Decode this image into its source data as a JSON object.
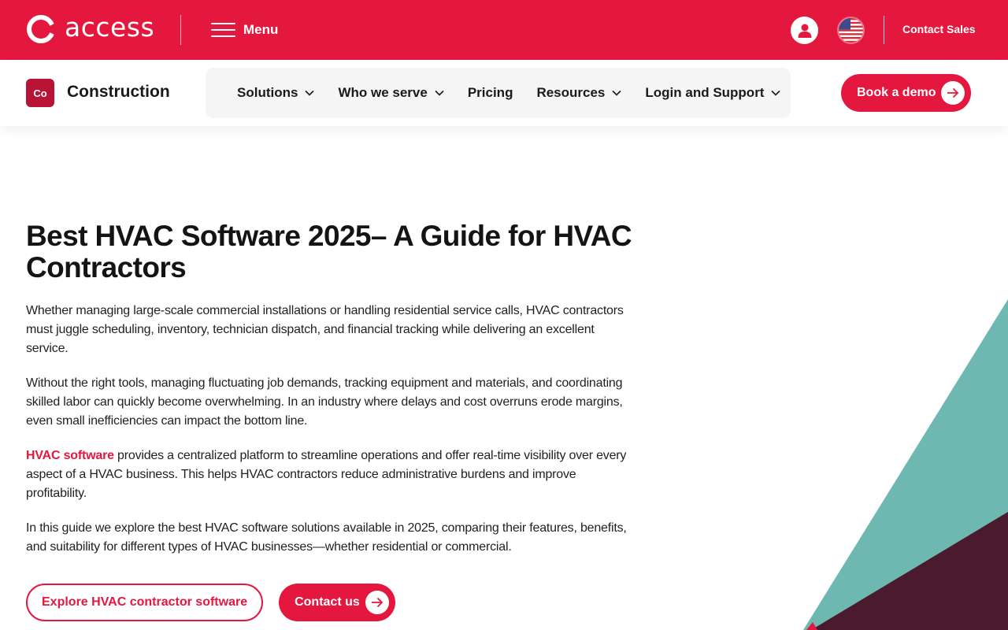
{
  "brand": {
    "logo_text": "access",
    "menu_label": "Menu",
    "contact_sales": "Contact Sales",
    "accent_color": "#e4173e",
    "user_icon": "user-icon",
    "flag_icon": "us-flag-icon"
  },
  "subnav": {
    "badge": "Co",
    "product_name": "Construction",
    "items": [
      {
        "label": "Solutions",
        "has_dropdown": true
      },
      {
        "label": "Who we serve",
        "has_dropdown": true
      },
      {
        "label": "Pricing",
        "has_dropdown": false
      },
      {
        "label": "Resources",
        "has_dropdown": true
      },
      {
        "label": "Login and Support",
        "has_dropdown": true
      }
    ],
    "book_demo": "Book a demo"
  },
  "article": {
    "title": "Best HVAC Software 2025– A Guide for HVAC Contractors",
    "p1": "Whether managing large-scale commercial installations or handling residential service calls, HVAC contractors must juggle scheduling, inventory, technician dispatch, and financial tracking while delivering an excellent service.",
    "p2": "Without the right tools, managing fluctuating job demands, tracking equipment and materials, and coordinating skilled labor can quickly become overwhelming. In an industry where delays and cost overruns erode margins, even small inefficiencies can impact the bottom line.",
    "p3_link": "HVAC software",
    "p3_rest": " provides a centralized platform to streamline operations and offer real-time visibility over every aspect of a HVAC business. This helps HVAC contractors reduce administrative burdens and improve profitability.",
    "p4": "In this guide we explore the best HVAC software solutions available in 2025, comparing their features, benefits, and suitability for different types of HVAC businesses—whether residential or commercial."
  },
  "cta": {
    "explore": "Explore HVAC contractor software",
    "contact": "Contact us"
  },
  "decor_colors": {
    "teal": "#6fb8b2",
    "plum": "#4a1a2e",
    "red": "#e4173e"
  }
}
